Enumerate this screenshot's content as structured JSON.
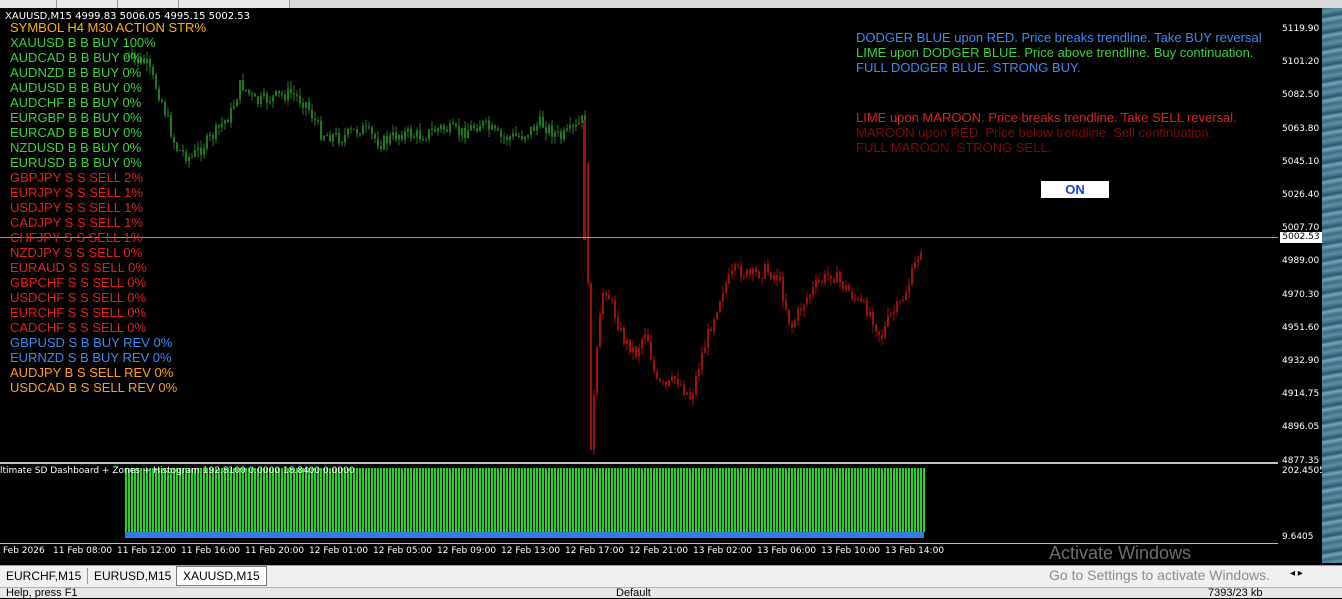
{
  "chart_header": "XAUUSD,M15  4999.83 5006.05 4995.15 5002.53",
  "dashboard": {
    "header": "SYMBOL H4 M30 ACTION STR%",
    "header_color": "#ffb300",
    "rows": [
      {
        "text": "XAUUSD B B BUY 100%",
        "color": "#3cd23c"
      },
      {
        "text": "AUDCAD B B BUY 0%",
        "color": "#3cd23c"
      },
      {
        "text": "AUDNZD B B BUY 0%",
        "color": "#3cd23c"
      },
      {
        "text": "AUDUSD B B BUY 0%",
        "color": "#3cd23c"
      },
      {
        "text": "AUDCHF B B BUY 0%",
        "color": "#3cd23c"
      },
      {
        "text": "EURGBP B B BUY 0%",
        "color": "#3cd23c"
      },
      {
        "text": "EURCAD B B BUY 0%",
        "color": "#3cd23c"
      },
      {
        "text": "NZDUSD B B BUY 0%",
        "color": "#3cd23c"
      },
      {
        "text": "EURUSD B B BUY 0%",
        "color": "#3cd23c"
      },
      {
        "text": "GBPJPY S S SELL 2%",
        "color": "#e02020"
      },
      {
        "text": "EURJPY S S SELL 1%",
        "color": "#e02020"
      },
      {
        "text": "USDJPY S S SELL 1%",
        "color": "#e02020"
      },
      {
        "text": "CADJPY S S SELL 1%",
        "color": "#e02020"
      },
      {
        "text": "CHFJPY S S SELL 1%",
        "color": "#e02020"
      },
      {
        "text": "NZDJPY S S SELL 0%",
        "color": "#e02020"
      },
      {
        "text": "EURAUD S S SELL 0%",
        "color": "#e02020"
      },
      {
        "text": "GBPCHF S S SELL 0%",
        "color": "#e02020"
      },
      {
        "text": "USDCHF S S SELL 0%",
        "color": "#e02020"
      },
      {
        "text": "EURCHF S S SELL 0%",
        "color": "#e02020"
      },
      {
        "text": "CADCHF S S SELL 0%",
        "color": "#e02020"
      },
      {
        "text": "GBPUSD S B BUY REV 0%",
        "color": "#3a8df0"
      },
      {
        "text": "EURNZD S B BUY REV 0%",
        "color": "#3a8df0"
      },
      {
        "text": "AUDJPY B S SELL REV 0%",
        "color": "#ffa020"
      },
      {
        "text": "USDCAD B S SELL REV 0%",
        "color": "#ffa020"
      }
    ]
  },
  "legend": [
    {
      "text": "DODGER BLUE upon RED. Price breaks trendline. Take BUY reversal",
      "color": "#3a8df0"
    },
    {
      "text": "LIME upon DODGER BLUE. Price above trendline. Buy continuation.",
      "color": "#3cd23c"
    },
    {
      "text": "FULL DODGER BLUE. STRONG BUY.",
      "color": "#3a8df0"
    },
    {
      "text": "LIME upon MAROON. Price breaks trendline. Take SELL reversal.",
      "color": "#e02020"
    },
    {
      "text": "MAROON upon RED. Price below trendline. Sell continuation.",
      "color": "#7a0c0c"
    },
    {
      "text": "FULL MAROON. STRONG SELL.",
      "color": "#7a0c0c"
    }
  ],
  "on_button": "ON",
  "price_axis": {
    "ticks": [
      "5119.90",
      "5101.20",
      "5082.50",
      "5063.80",
      "5045.10",
      "5026.40",
      "5007.70",
      "4989.00",
      "4970.30",
      "4951.60",
      "4932.90",
      "4914.75",
      "4896.05",
      "4877.35"
    ],
    "current": "5002.53"
  },
  "indicator": {
    "title": "ltimate SD Dashboard + Zones + Histogram 192.8100 0.0000 18.8400 0.0000",
    "scale_top": "202.4505",
    "scale_bottom": "9.6405",
    "bar_color": "#22d622",
    "base_color": "#2f7fe0"
  },
  "time_axis": [
    "Feb 2026",
    "11 Feb 08:00",
    "11 Feb 12:00",
    "11 Feb 16:00",
    "11 Feb 20:00",
    "12 Feb 01:00",
    "12 Feb 05:00",
    "12 Feb 09:00",
    "12 Feb 13:00",
    "12 Feb 17:00",
    "12 Feb 21:00",
    "13 Feb 02:00",
    "13 Feb 06:00",
    "13 Feb 10:00",
    "13 Feb 14:00"
  ],
  "chart_tabs": [
    {
      "label": "EURCHF,M15",
      "active": false
    },
    {
      "label": "EURUSD,M15",
      "active": false
    },
    {
      "label": "XAUUSD,M15",
      "active": true
    }
  ],
  "watermark": {
    "line1": "Activate Windows",
    "line2": "Go to Settings to activate Windows."
  },
  "status": {
    "left": "Help, press F1",
    "middle": "Default",
    "right": "7393/23 kb"
  },
  "colors": {
    "bull_candle": "#1f7a1f",
    "bear_candle": "#a00d0d",
    "price_line": "#7f9fc0"
  }
}
